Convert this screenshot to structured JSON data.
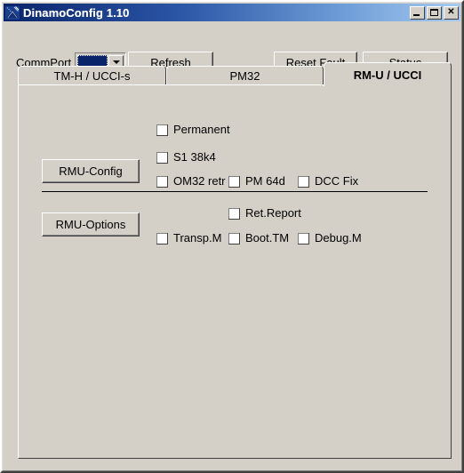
{
  "window": {
    "title": "DinamoConfig 1.10",
    "icon": "app-logo-icon",
    "controls": {
      "minimize": "_",
      "maximize": "□",
      "close": "✕"
    },
    "colors": {
      "titlebar_start": "#0a246a",
      "titlebar_end": "#a6caf0",
      "face": "#d4d0c8",
      "shadow": "#404040",
      "highlight": "#ffffff",
      "selection": "#0a246a"
    }
  },
  "toolbar": {
    "commport_label": "CommPort",
    "commport_value": "",
    "commport_options": [],
    "refresh_label": "Refresh",
    "reset_fault_label": "Reset Fault",
    "status_label": "Status"
  },
  "tabs": [
    {
      "label": "TM-H / UCCI-s",
      "active": false
    },
    {
      "label": "PM32",
      "active": false
    },
    {
      "label": "RM-U / UCCI",
      "active": true
    }
  ],
  "panel": {
    "permanent": {
      "label": "Permanent",
      "checked": false
    },
    "config_section": {
      "button_label": "RMU-Config",
      "checkboxes": [
        {
          "label": "S1 38k4",
          "checked": false
        },
        {
          "label": "OM32 retr",
          "checked": false
        },
        {
          "label": "PM 64d",
          "checked": false
        },
        {
          "label": "DCC Fix",
          "checked": false
        }
      ]
    },
    "options_section": {
      "button_label": "RMU-Options",
      "checkboxes": [
        {
          "label": "Ret.Report",
          "checked": false
        },
        {
          "label": "Transp.M",
          "checked": false
        },
        {
          "label": "Boot.TM",
          "checked": false
        },
        {
          "label": "Debug.M",
          "checked": false
        }
      ]
    }
  }
}
